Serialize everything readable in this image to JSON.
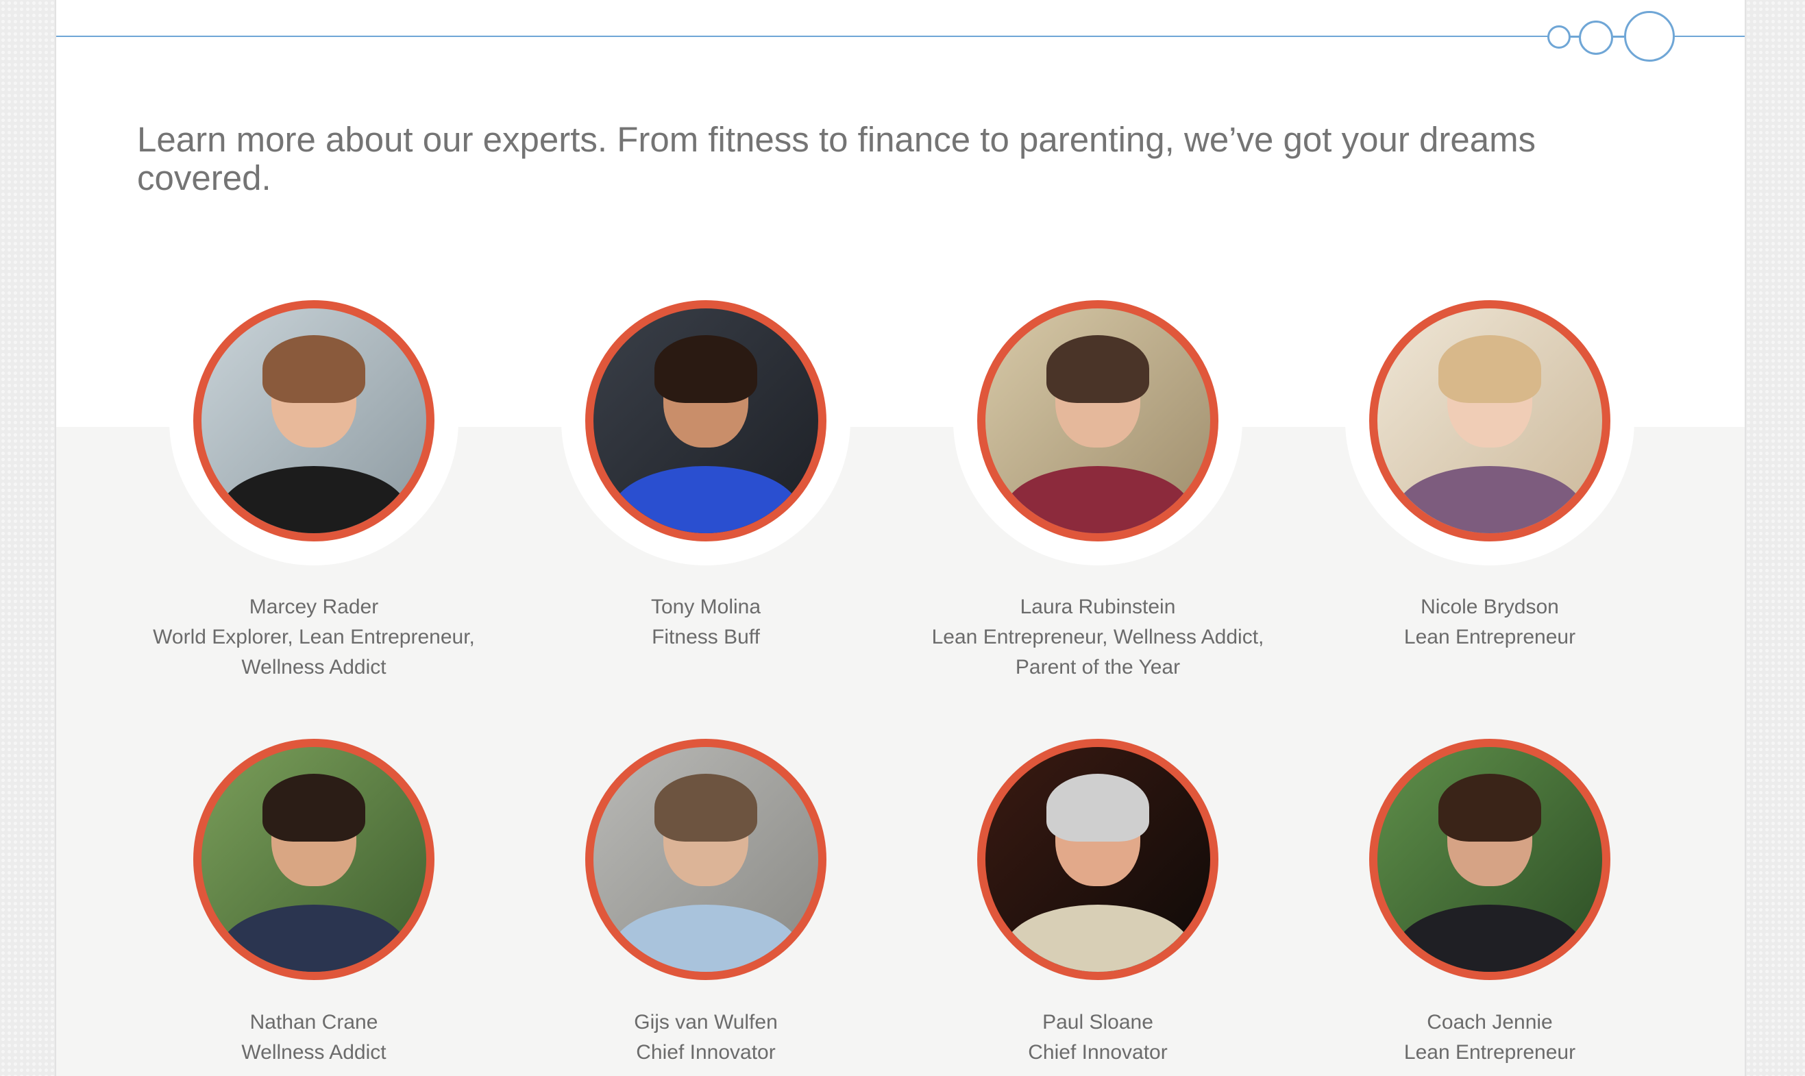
{
  "intro": {
    "text_line1": "Learn more about our experts. From fitness to finance to parenting, we’ve got your dreams",
    "text_line2": "covered."
  },
  "colors": {
    "accent_ring": "#e0573b",
    "rule_blue": "#6fa6d6",
    "text_gray": "#6b6b6b",
    "band_gray": "#f5f5f4"
  },
  "experts": [
    {
      "name": "Marcey Rader",
      "roles": [
        "World Explorer, Lean Entrepreneur,",
        "Wellness Addict"
      ]
    },
    {
      "name": "Tony Molina",
      "roles": [
        "Fitness Buff"
      ]
    },
    {
      "name": "Laura Rubinstein",
      "roles": [
        "Lean Entrepreneur, Wellness Addict,",
        "Parent of the Year"
      ]
    },
    {
      "name": "Nicole Brydson",
      "roles": [
        "Lean Entrepreneur"
      ]
    },
    {
      "name": "Nathan Crane",
      "roles": [
        "Wellness Addict"
      ]
    },
    {
      "name": "Gijs van Wulfen",
      "roles": [
        "Chief Innovator"
      ]
    },
    {
      "name": "Paul Sloane",
      "roles": [
        "Chief Innovator"
      ]
    },
    {
      "name": "Coach Jennie",
      "roles": [
        "Lean Entrepreneur"
      ]
    }
  ]
}
